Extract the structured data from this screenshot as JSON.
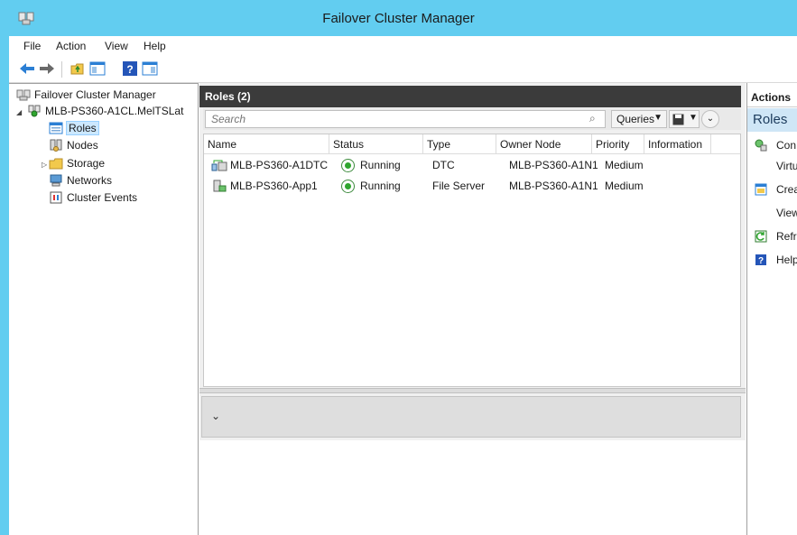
{
  "window": {
    "title": "Failover Cluster Manager"
  },
  "menu": [
    "File",
    "Action",
    "View",
    "Help"
  ],
  "tree": {
    "root": "Failover Cluster Manager",
    "cluster": "MLB-PS360-A1CL.MelTSLat",
    "items": [
      "Roles",
      "Nodes",
      "Storage",
      "Networks",
      "Cluster Events"
    ]
  },
  "roles": {
    "header": "Roles (2)",
    "search_placeholder": "Search",
    "queries_label": "Queries",
    "columns": [
      "Name",
      "Status",
      "Type",
      "Owner Node",
      "Priority",
      "Information"
    ],
    "rows": [
      {
        "name": "MLB-PS360-A1DTC",
        "status": "Running",
        "type": "DTC",
        "owner": "MLB-PS360-A1N1",
        "priority": "Medium",
        "info": ""
      },
      {
        "name": "MLB-PS360-App1",
        "status": "Running",
        "type": "File Server",
        "owner": "MLB-PS360-A1N1",
        "priority": "Medium",
        "info": ""
      }
    ]
  },
  "actions": {
    "title": "Actions",
    "section": "Roles",
    "items": [
      "Con",
      "Virtu",
      "Crea",
      "View",
      "Refr",
      "Help"
    ]
  }
}
